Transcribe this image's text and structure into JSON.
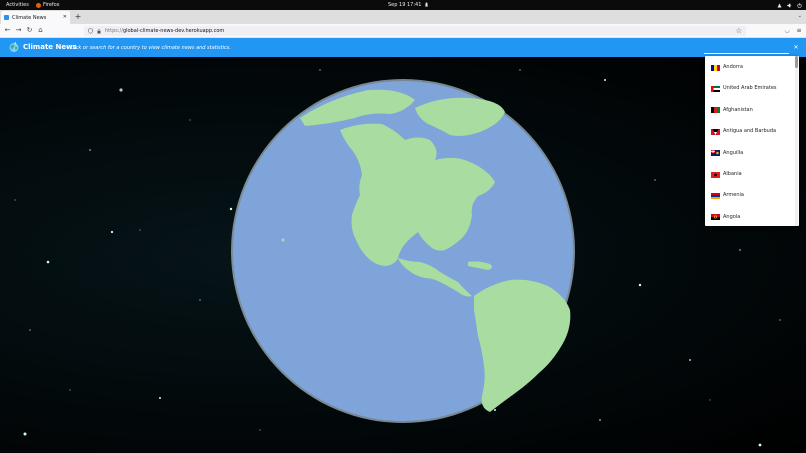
{
  "system_bar": {
    "activities": "Activities",
    "app_name": "Firefox",
    "clock": "Sep 19  17:41"
  },
  "browser": {
    "tab_title": "Climate News",
    "url_prefix": "https://",
    "url_host": "global-climate-news-dev.herokuapp.com"
  },
  "app": {
    "title": "Climate News",
    "subtitle": "- Click or search for a country to view climate news and statistics."
  },
  "search": {
    "value": "",
    "placeholder": ""
  },
  "countries": [
    {
      "name": "Andorra",
      "flag": [
        "#10069f",
        "#fedf00",
        "#d50032"
      ],
      "dir": "v"
    },
    {
      "name": "United Arab Emirates",
      "flag": [
        "#00732f",
        "#ffffff",
        "#000000"
      ],
      "dir": "uae"
    },
    {
      "name": "Afghanistan",
      "flag": [
        "#000000",
        "#d32011",
        "#007a36"
      ],
      "dir": "v"
    },
    {
      "name": "Antigua and Barbuda",
      "flag": [
        "#ce1126",
        "#000000",
        "#ffffff"
      ],
      "dir": "ag"
    },
    {
      "name": "Anguilla",
      "flag": [
        "#012169",
        "#ffffff",
        "#c8102e"
      ],
      "dir": "ai"
    },
    {
      "name": "Albania",
      "flag": [
        "#e41e20",
        "#000000",
        "#e41e20"
      ],
      "dir": "solid"
    },
    {
      "name": "Armenia",
      "flag": [
        "#d90012",
        "#0033a0",
        "#f2a800"
      ],
      "dir": "h"
    },
    {
      "name": "Angola",
      "flag": [
        "#cc092f",
        "#000000",
        "#f5d000"
      ],
      "dir": "ao"
    }
  ],
  "scroll": {
    "position": 0.0
  }
}
